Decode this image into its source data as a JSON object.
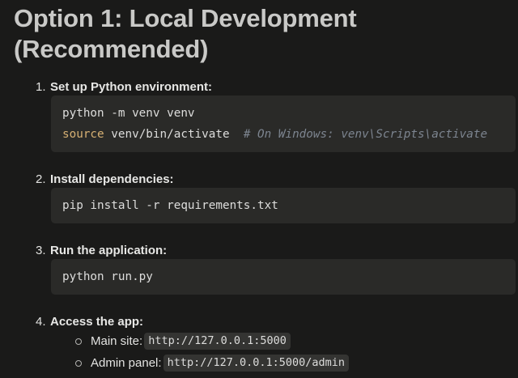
{
  "heading": {
    "text": "Option 1: Local Development (Recommended)"
  },
  "steps": [
    {
      "number": "1.",
      "label": "Set up Python environment:",
      "code": [
        [
          {
            "t": "python -m venv venv",
            "s": "plain"
          }
        ],
        [
          {
            "t": "source",
            "s": "keyword"
          },
          {
            "t": " venv/bin/activate  ",
            "s": "plain"
          },
          {
            "t": "# On Windows: venv\\Scripts\\activate",
            "s": "comment"
          }
        ]
      ]
    },
    {
      "number": "2.",
      "label": "Install dependencies:",
      "code": [
        [
          {
            "t": "pip install -r requirements.txt",
            "s": "plain"
          }
        ]
      ]
    },
    {
      "number": "3.",
      "label": "Run the application:",
      "code": [
        [
          {
            "t": "python run.py",
            "s": "plain"
          }
        ]
      ]
    },
    {
      "number": "4.",
      "label": "Access the app:",
      "bullets": [
        {
          "text": "Main site: ",
          "code": "http://127.0.0.1:5000"
        },
        {
          "text": "Admin panel: ",
          "code": "http://127.0.0.1:5000/admin"
        }
      ]
    }
  ],
  "colors": {
    "page_background": "#1a1a19",
    "heading_text": "#c9c9c7",
    "body_text": "#e3e3e1",
    "bold_label_text": "#e7e7e5",
    "code_block_background": "#2a2a28",
    "code_text": "#dddddc",
    "keyword_token": "#d6b073",
    "comment_token": "#7d8590",
    "inline_code_background": "#343432",
    "inline_code_text": "#dcdcdb",
    "bullet_outline": "#b3b3b1"
  }
}
